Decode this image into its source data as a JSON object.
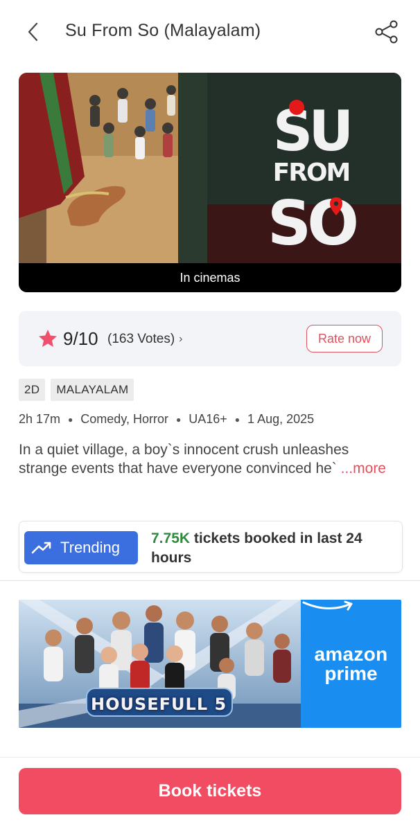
{
  "header": {
    "title": "Su From So (Malayalam)"
  },
  "poster": {
    "logo_text": [
      "SU",
      "FROM",
      "SO"
    ],
    "caption": "In cinemas"
  },
  "rating": {
    "score": "9/10",
    "votes": "(163 Votes)",
    "rate_label": "Rate now",
    "star_color": "#f0506e"
  },
  "tags": [
    "2D",
    "MALAYALAM"
  ],
  "meta": {
    "duration": "2h 17m",
    "genres": "Comedy, Horror",
    "certificate": "UA16+",
    "release_date": "1 Aug, 2025"
  },
  "description": {
    "text": "In a quiet village, a boy`s innocent crush unleashes strange events that have everyone convinced he`",
    "more_label": "...more"
  },
  "trending": {
    "badge_label": "Trending",
    "count": "7.75K",
    "text": " tickets booked in last 24 hours"
  },
  "ad": {
    "movie_title": "HOUSEFULL 5",
    "brand_line1": "amazon",
    "brand_line2": "prime"
  },
  "footer": {
    "book_label": "Book tickets",
    "accent": "#f24c63"
  }
}
